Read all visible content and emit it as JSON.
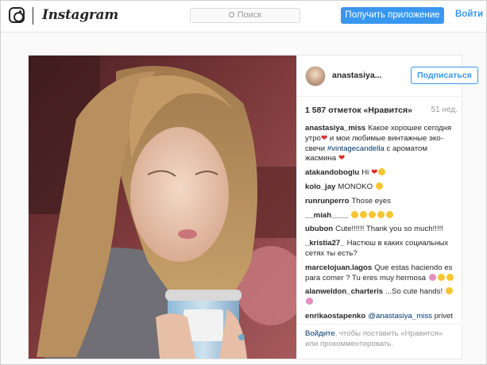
{
  "header": {
    "logo_text": "Instagram",
    "search_placeholder": "Поиск",
    "get_app_label": "Получить приложение",
    "login_label": "Войти"
  },
  "post": {
    "username": "anastasiya...",
    "follow_label": "Подписаться",
    "likes": "1 587 отметок «Нравится»",
    "age": "51 нед.",
    "comments": [
      {
        "author": "anastasiya_miss",
        "text": "Какое хорошее сегодня утро",
        "emoji_after": "heart",
        "text2": " и мои любимые винтажные эко-свечи ",
        "tag": "#vintagecandella",
        "text3": " с ароматом жасмина ",
        "emoji_end": "heart"
      },
      {
        "author": "atakandoboglu",
        "text": "Hi",
        "emoji_after": "heart",
        "emoji_end": "yellow"
      },
      {
        "author": "kolo_jay",
        "text": "MONOKO",
        "emoji_end": "yellow"
      },
      {
        "author": "runrunperro",
        "text": "Those eyes"
      },
      {
        "author": "__miah____",
        "text": "",
        "emojis": [
          "yellow",
          "yellow",
          "yellow",
          "yellow",
          "yellow"
        ]
      },
      {
        "author": "ububon",
        "text": "Cute!!!!!! Thank you so much!!!!!"
      },
      {
        "author": "_kristia27_",
        "text": "Настюш в каких социальных сетях ты есть?"
      },
      {
        "author": "marcelojuan.lagos",
        "text": "Que estas haciendo es para comer ? Tu eres muy hermosa",
        "emojis": [
          "pink",
          "yellow",
          "yellow"
        ]
      },
      {
        "author": "alanweldon_charteris",
        "text": "...So cute hands!",
        "emojis": [
          "yellow",
          "yellow"
        ]
      },
      {
        "author": "enrikaostapenko",
        "tag": "@anastasiya_miss",
        "text": " privet daj mne skype svoj :)) pozvaniu"
      }
    ],
    "login_link": "Войдите",
    "login_text": ", чтобы поставить «Нравится» или прокомментировать."
  },
  "colors": {
    "accent": "#3897f0",
    "link_dark": "#003569",
    "muted": "#999999"
  },
  "icons": [
    "instagram-camera-icon",
    "search-icon"
  ]
}
